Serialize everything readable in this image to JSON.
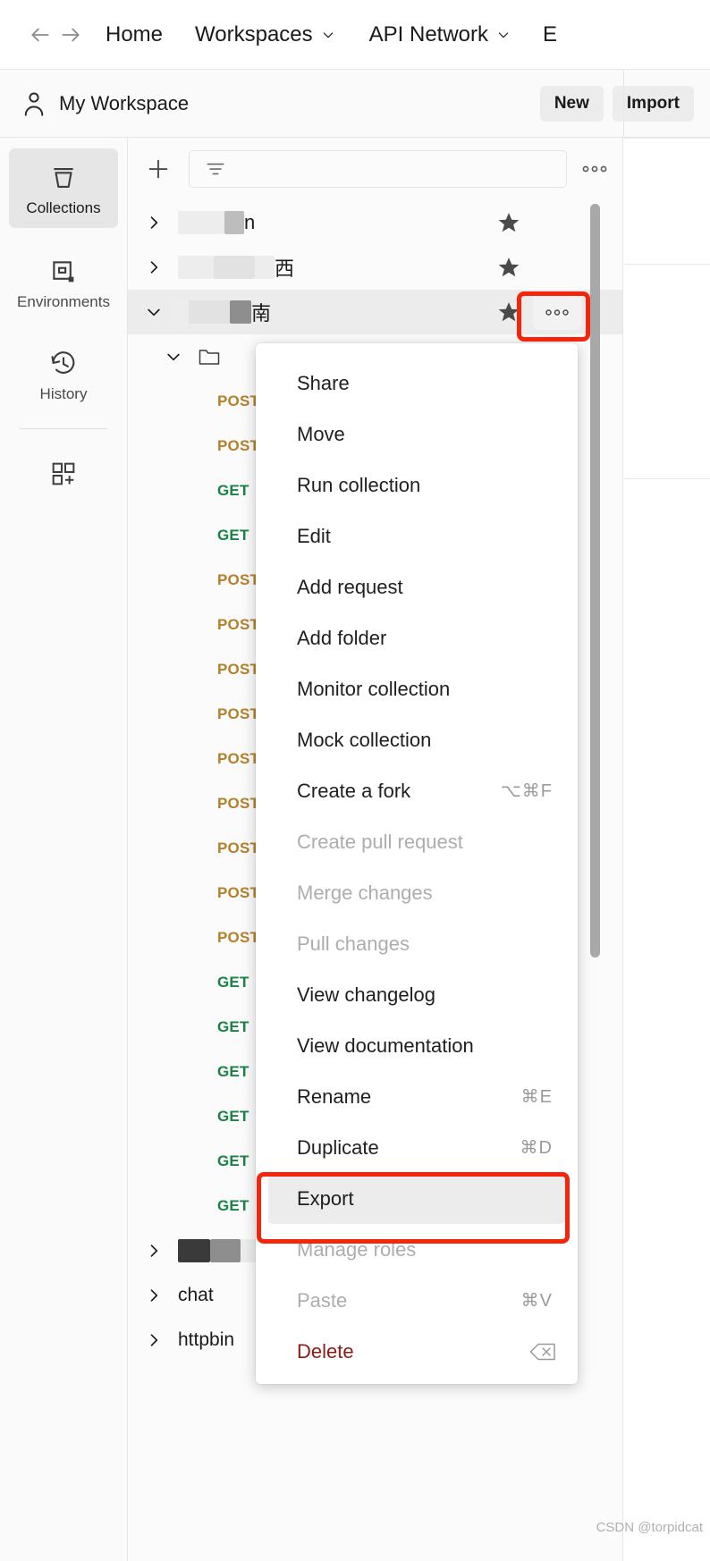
{
  "topnav": {
    "back_icon": "arrow-left-icon",
    "forward_icon": "arrow-right-icon",
    "home": "Home",
    "workspaces": "Workspaces",
    "api_network": "API Network",
    "explore_truncated": "E"
  },
  "workspace_bar": {
    "avatar_icon": "person-icon",
    "title": "My Workspace",
    "new_label": "New",
    "import_label": "Import"
  },
  "rail": {
    "items": [
      {
        "label": "Collections",
        "icon": "collection-icon",
        "active": true
      },
      {
        "label": "Environments",
        "icon": "environment-icon",
        "active": false
      },
      {
        "label": "History",
        "icon": "history-icon",
        "active": false
      }
    ],
    "new_pane_icon": "new-pane-icon"
  },
  "sidebar": {
    "add_icon": "plus-icon",
    "filter_placeholder": "",
    "filter_icon": "filter-icon",
    "more_icon": "ellipsis-icon",
    "collections": [
      {
        "name_suffix": "n",
        "redacted": true,
        "starred": true,
        "expanded": false
      },
      {
        "name_suffix": "西",
        "redacted": true,
        "starred": true,
        "expanded": false
      },
      {
        "name_suffix": "南",
        "redacted": true,
        "starred": true,
        "expanded": true,
        "selected": true,
        "show_dots": true
      }
    ],
    "folder_label": "",
    "requests": [
      {
        "method": "POST",
        "label": ""
      },
      {
        "method": "POST",
        "label": ""
      },
      {
        "method": "GET",
        "label": ""
      },
      {
        "method": "GET",
        "label": ""
      },
      {
        "method": "POST",
        "label": ""
      },
      {
        "method": "POST",
        "label": ""
      },
      {
        "method": "POST",
        "label": ""
      },
      {
        "method": "POST",
        "label": ""
      },
      {
        "method": "POST",
        "label": ""
      },
      {
        "method": "POST",
        "label": ""
      },
      {
        "method": "POST",
        "label": ""
      },
      {
        "method": "POST",
        "label": ""
      },
      {
        "method": "POST",
        "label": ""
      },
      {
        "method": "GET",
        "label": ""
      },
      {
        "method": "GET",
        "label": ""
      },
      {
        "method": "GET",
        "label": ""
      },
      {
        "method": "GET",
        "label": ""
      },
      {
        "method": "GET",
        "label": ""
      },
      {
        "method": "GET",
        "label": ""
      }
    ],
    "bottom_collections": [
      {
        "name": "",
        "redacted": true
      },
      {
        "name": "chat",
        "redacted": false
      },
      {
        "name": "httpbin",
        "redacted": false
      }
    ]
  },
  "context_menu": {
    "items": [
      {
        "label": "Share",
        "shortcut": "",
        "state": "normal"
      },
      {
        "label": "Move",
        "shortcut": "",
        "state": "normal"
      },
      {
        "label": "Run collection",
        "shortcut": "",
        "state": "normal"
      },
      {
        "label": "Edit",
        "shortcut": "",
        "state": "normal"
      },
      {
        "label": "Add request",
        "shortcut": "",
        "state": "normal"
      },
      {
        "label": "Add folder",
        "shortcut": "",
        "state": "normal"
      },
      {
        "label": "Monitor collection",
        "shortcut": "",
        "state": "normal"
      },
      {
        "label": "Mock collection",
        "shortcut": "",
        "state": "normal"
      },
      {
        "label": "Create a fork",
        "shortcut": "⌥⌘F",
        "state": "normal"
      },
      {
        "label": "Create pull request",
        "shortcut": "",
        "state": "disabled"
      },
      {
        "label": "Merge changes",
        "shortcut": "",
        "state": "disabled"
      },
      {
        "label": "Pull changes",
        "shortcut": "",
        "state": "disabled"
      },
      {
        "label": "View changelog",
        "shortcut": "",
        "state": "normal"
      },
      {
        "label": "View documentation",
        "shortcut": "",
        "state": "normal"
      },
      {
        "label": "Rename",
        "shortcut": "⌘E",
        "state": "normal"
      },
      {
        "label": "Duplicate",
        "shortcut": "⌘D",
        "state": "normal"
      },
      {
        "label": "Export",
        "shortcut": "",
        "state": "highlight"
      },
      {
        "label": "Manage roles",
        "shortcut": "",
        "state": "disabled"
      },
      {
        "label": "Paste",
        "shortcut": "⌘V",
        "state": "disabled"
      },
      {
        "label": "Delete",
        "shortcut": "backspace-icon",
        "state": "danger"
      }
    ]
  },
  "annotations": {
    "accent_color": "#f5250c",
    "boxes": [
      {
        "target": "collection-more-button"
      },
      {
        "target": "menu-item-export"
      }
    ]
  },
  "watermark": "CSDN @torpidcat"
}
